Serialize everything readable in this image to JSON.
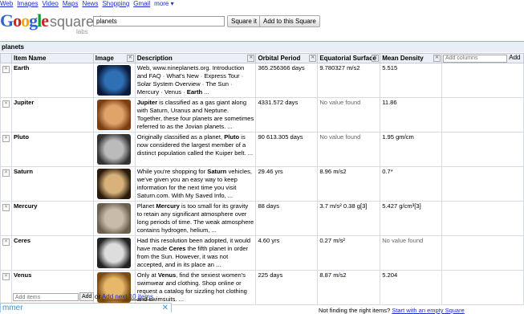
{
  "topnav": {
    "web": "Web",
    "images": "Images",
    "video": "Video",
    "maps": "Maps",
    "news": "News",
    "shopping": "Shopping",
    "gmail": "Gmail",
    "more": "more ▾"
  },
  "logo": {
    "google": "Google",
    "squared": "squared",
    "labs": "labs"
  },
  "search": {
    "value": "planets"
  },
  "buttons": {
    "square_it": "Square it",
    "add_to_square": "Add to this Square"
  },
  "square_title": "planets",
  "columns": {
    "item_name": "Item Name",
    "image": "Image",
    "description": "Description",
    "orbital_period": "Orbital Period",
    "equatorial_surface": "Equatorial Surface",
    "mean_density": "Mean Density",
    "add_columns_placeholder": "Add columns",
    "add_button": "Add"
  },
  "rows": [
    {
      "name": "Earth",
      "desc_pre": "Web, www.nineplanets.org. Introduction and FAQ · What's New · Express Tour · Solar System Overview · The Sun · Mercury · Venus · ",
      "desc_bold": "Earth",
      "desc_post": " ...",
      "orbital": "365.256366 days",
      "surface": "9.780327 m/s2",
      "density": "5.515",
      "color_a": "#2f6fb3",
      "color_b": "#0a1a3a"
    },
    {
      "name": "Jupiter",
      "desc_pre": "",
      "desc_bold": "Jupiter",
      "desc_post": " is classified as a gas giant along with Saturn, Uranus and Neptune. Together, these four planets are sometimes referred to as the Jovian planets. ...",
      "orbital": "4331.572 days",
      "surface": "No value found",
      "density": "11.86",
      "color_a": "#e0a36a",
      "color_b": "#7a3e12"
    },
    {
      "name": "Pluto",
      "desc_pre": "Originally classified as a planet, ",
      "desc_bold": "Pluto",
      "desc_post": " is now considered the largest member of a distinct population called the Kuiper belt. ...",
      "orbital": "90 613.305 days",
      "surface": "No value found",
      "density": "1.95 gm/cm",
      "color_a": "#bbbbbb",
      "color_b": "#333333"
    },
    {
      "name": "Saturn",
      "desc_pre": "While you're shopping for ",
      "desc_bold": "Saturn",
      "desc_post": " vehicles, we've given you an easy way to keep information for the next time you visit Saturn.com. With My Saved Info, ...",
      "orbital": "29.46 yrs",
      "surface": "8.96 m/s2",
      "density": "0.7*",
      "color_a": "#d8b27a",
      "color_b": "#2a1a0a"
    },
    {
      "name": "Mercury",
      "desc_pre": "Planet ",
      "desc_bold": "Mercury",
      "desc_post": " is too small for its gravity to retain any significant atmosphere over long periods of time. The weak atmosphere contains hydrogen, helium, ...",
      "orbital": "88 days",
      "surface": "3.7 m/s² 0.38 g[3]",
      "density": "5.427 g/cm³[3]",
      "color_a": "#c8bca8",
      "color_b": "#6a5e4e"
    },
    {
      "name": "Ceres",
      "desc_pre": "Had this resolution been adopted, it would have made ",
      "desc_bold": "Ceres",
      "desc_post": " the fifth planet in order from the Sun. However, it was not accepted, and in its place an ...",
      "orbital": "4.60 yrs",
      "surface": "0.27 m/s²",
      "density": "No value found",
      "color_a": "#dddddd",
      "color_b": "#222222"
    },
    {
      "name": "Venus",
      "desc_pre": "Only at ",
      "desc_bold": "Venus",
      "desc_post": ", find the sexiest women's swimwear and clothing. Shop online or request a catalog for sizzling hot clothing and swimsuits. ...",
      "orbital": "225 days",
      "surface": "8.87 m/s2",
      "density": "5.204",
      "color_a": "#e8b86a",
      "color_b": "#7a4a12"
    }
  ],
  "bottom": {
    "add_items_placeholder": "Add items",
    "add_label": "Add",
    "or_text": "or",
    "add_next": "Add next 10 items",
    "not_finding": "Not finding the right items?",
    "start_empty": "Start with an empty Square"
  },
  "popup": {
    "text": "mmer",
    "close": "✕"
  }
}
